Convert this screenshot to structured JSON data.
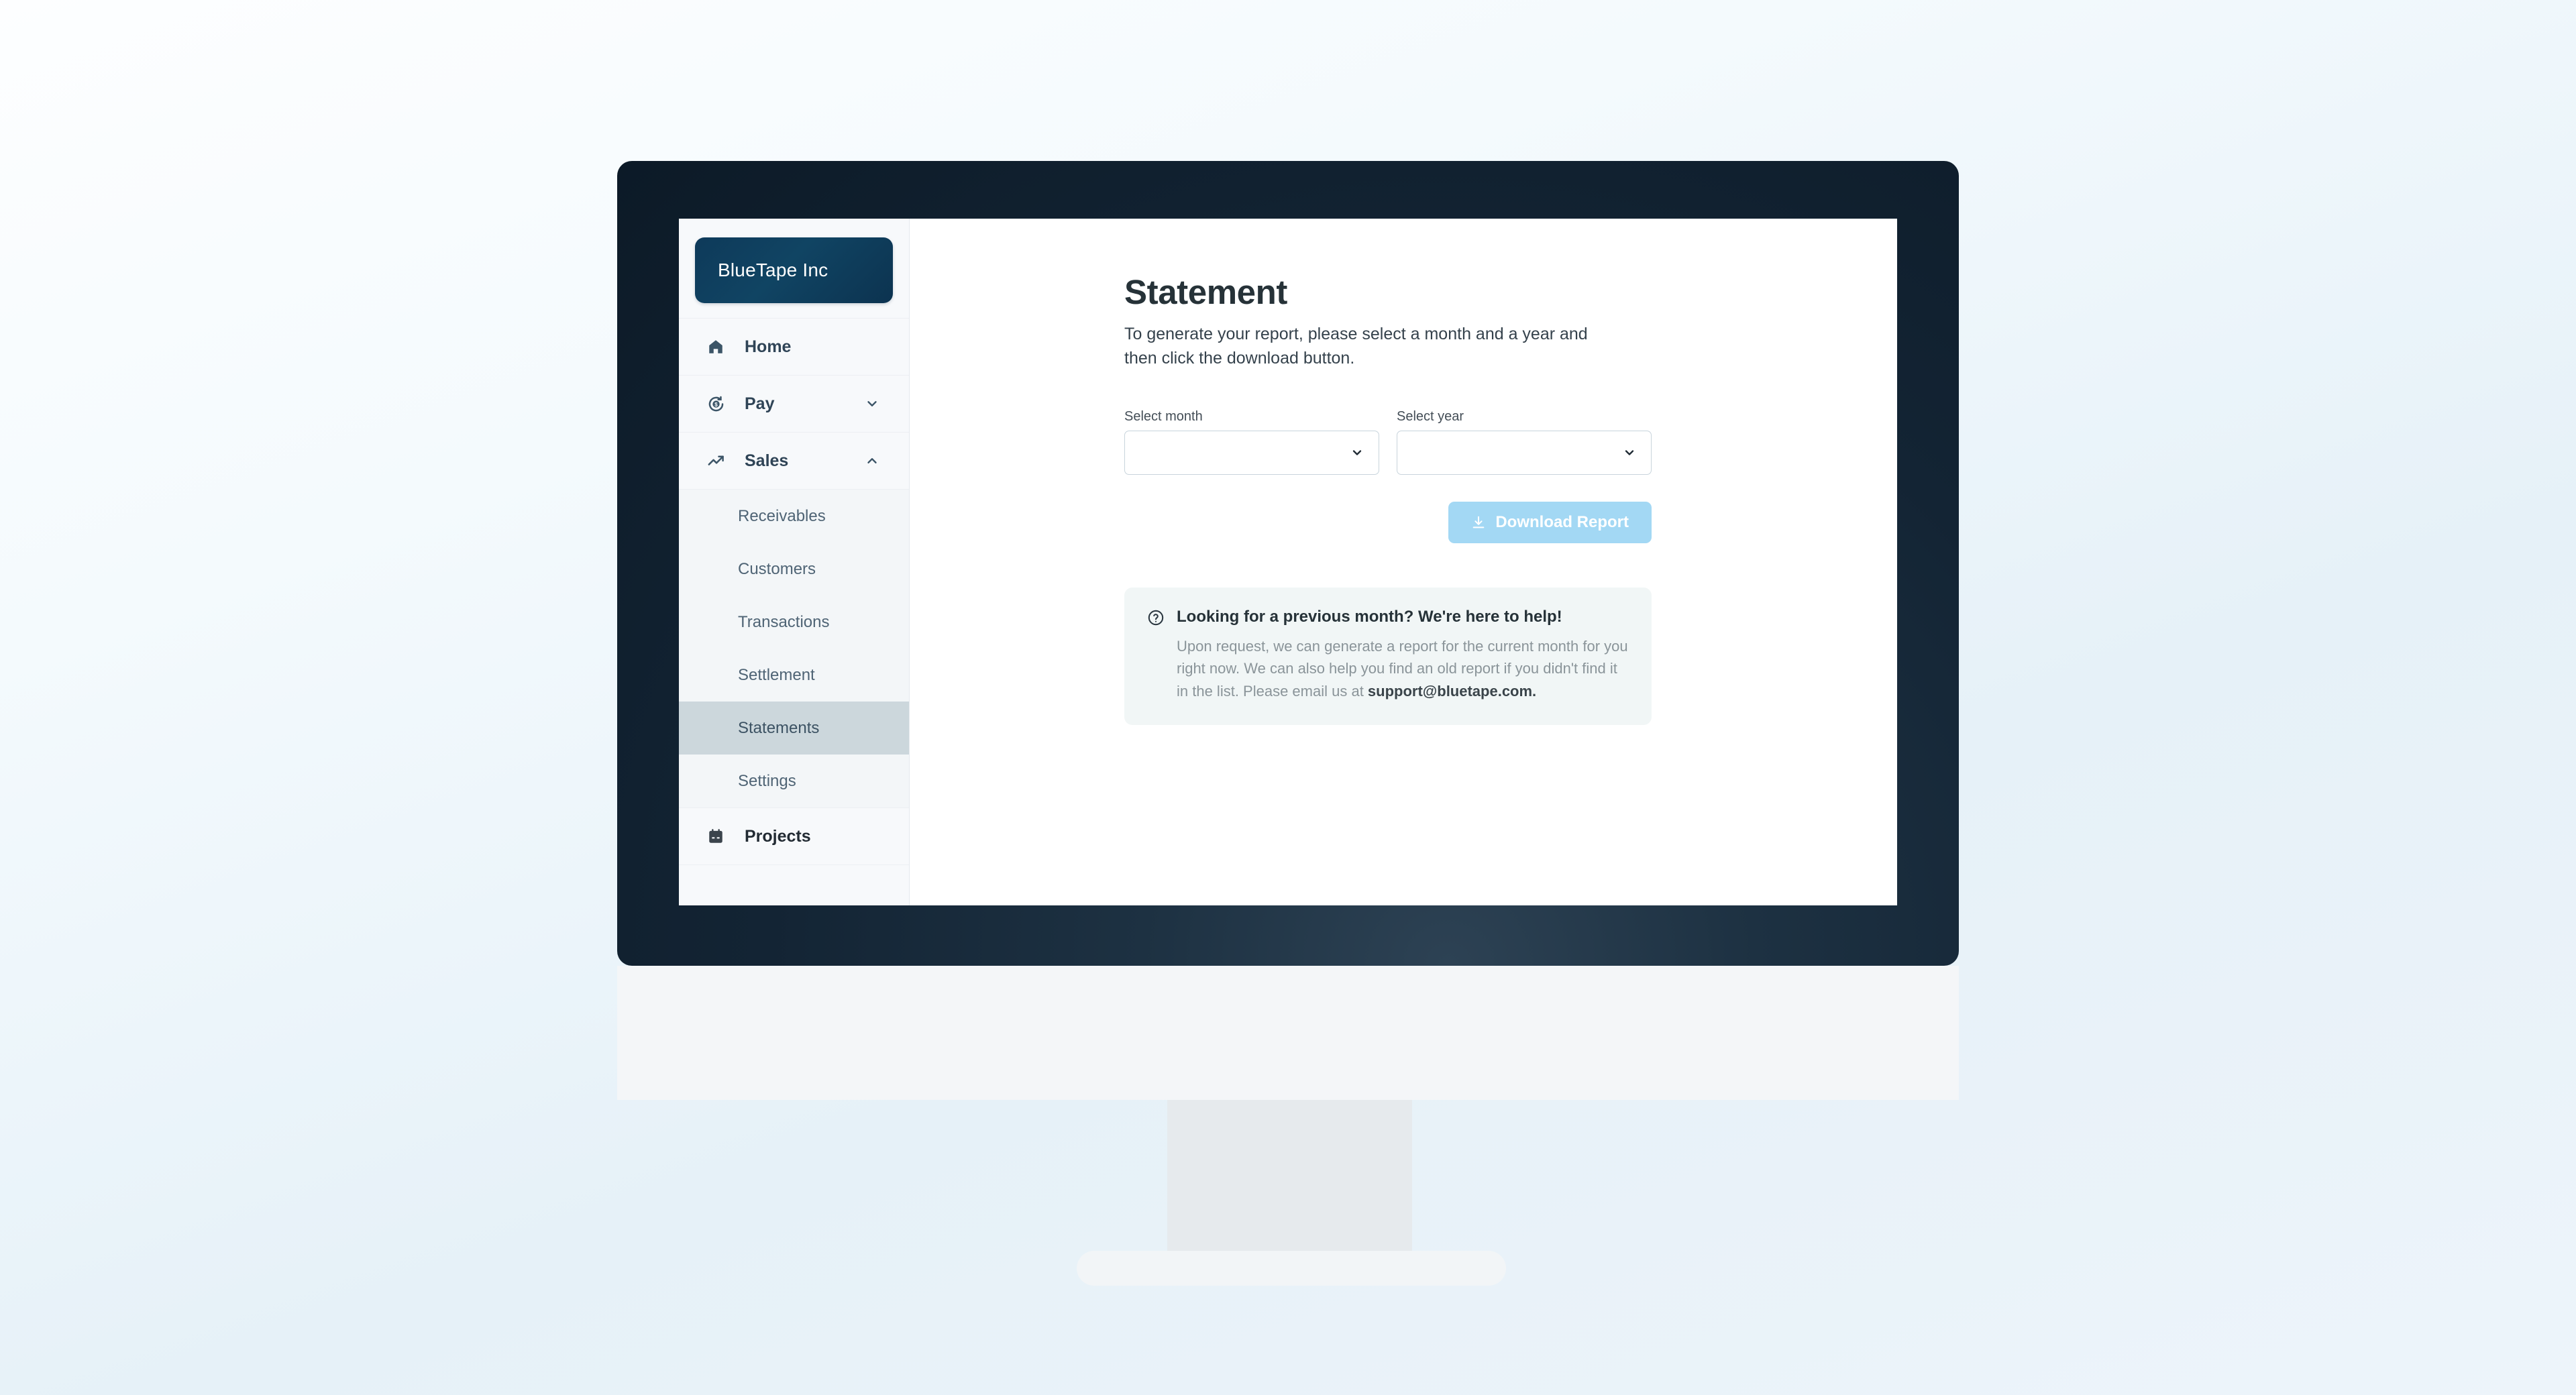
{
  "sidebar": {
    "logo": "BlueTape Inc",
    "nav": [
      {
        "label": "Home",
        "icon": "home-icon",
        "expandable": false
      },
      {
        "label": "Pay",
        "icon": "pay-circle-dollar-icon",
        "expandable": true,
        "expanded": false
      },
      {
        "label": "Sales",
        "icon": "trending-up-icon",
        "expandable": true,
        "expanded": true
      }
    ],
    "sales_subitems": [
      {
        "label": "Receivables",
        "active": false
      },
      {
        "label": "Customers",
        "active": false
      },
      {
        "label": "Transactions",
        "active": false
      },
      {
        "label": "Settlement",
        "active": false
      },
      {
        "label": "Statements",
        "active": true
      },
      {
        "label": "Settings",
        "active": false
      }
    ],
    "projects": {
      "label": "Projects",
      "icon": "calendar-icon"
    }
  },
  "main": {
    "title": "Statement",
    "description": "To generate your report, please select a month and a year and then click the download button.",
    "month_field": {
      "label": "Select month",
      "value": "",
      "chevron": "chevron-down-icon"
    },
    "year_field": {
      "label": "Select year",
      "value": "",
      "chevron": "chevron-down-icon"
    },
    "download_button": {
      "label": "Download Report",
      "icon": "download-icon",
      "color": "#a3d8f4"
    },
    "help": {
      "icon": "question-circle-icon",
      "title": "Looking for a previous month? We're here to help!",
      "body_1": "Upon request, we can generate a report for the current month for you right now. We can also help you find an old report if you didn't find it in the list. Please email us at ",
      "email": "support@bluetape.com.",
      "background": "#f1f6f6"
    }
  },
  "theme": {
    "brand_navy": "#0e3a5a",
    "bezel": "#132434",
    "active_nav_bg": "#ccd7dc",
    "page_bg": "#e6f1f8"
  }
}
